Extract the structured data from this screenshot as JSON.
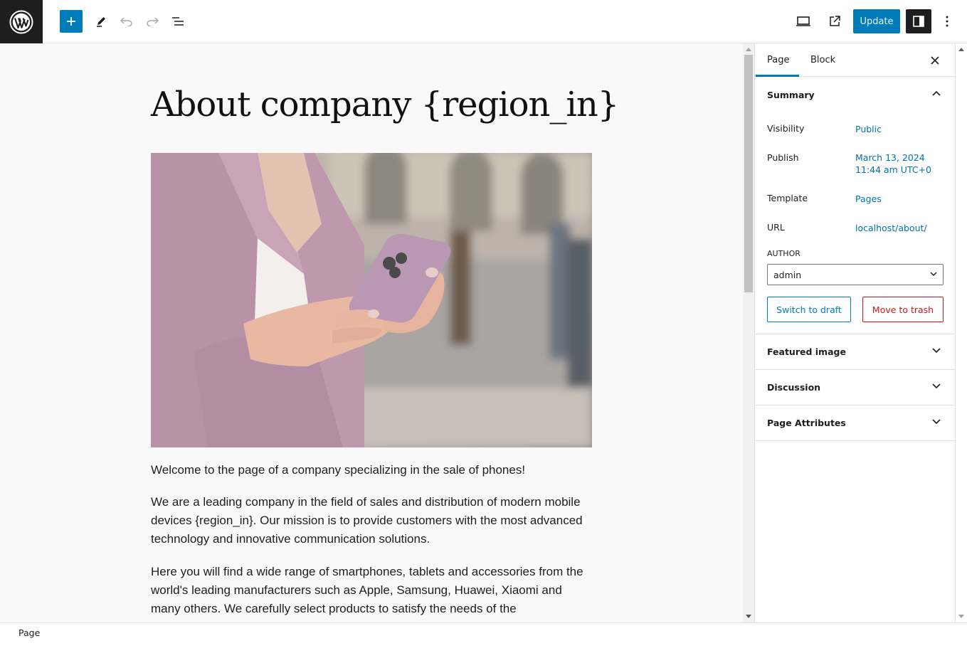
{
  "toolbar": {
    "update_label": "Update"
  },
  "editor": {
    "title": "About company {region_in}",
    "paragraphs": {
      "p1": "Welcome to the page of a company specializing in the sale of phones!",
      "p2": "We are a leading company in the field of sales and distribution of modern mobile devices {region_in}. Our mission is to provide customers with the most advanced technology and innovative communication solutions.",
      "p3": "Here you will find a wide range of smartphones, tablets and accessories from the world's leading manufacturers such as Apple, Samsung, Huawei, Xiaomi and many others. We carefully select products to satisfy the needs of the"
    }
  },
  "sidebar": {
    "tabs": {
      "page": "Page",
      "block": "Block"
    },
    "summary": {
      "heading": "Summary",
      "visibility_label": "Visibility",
      "visibility_value": "Public",
      "publish_label": "Publish",
      "publish_date": "March 13, 2024",
      "publish_time": "11:44 am UTC+0",
      "template_label": "Template",
      "template_value": "Pages",
      "url_label": "URL",
      "url_value": "localhost/about/",
      "author_label": "AUTHOR",
      "author_value": "admin",
      "switch_draft": "Switch to draft",
      "move_trash": "Move to trash"
    },
    "panels": {
      "featured": "Featured image",
      "discussion": "Discussion",
      "attributes": "Page Attributes"
    }
  },
  "footer": {
    "breadcrumb": "Page"
  },
  "colors": {
    "accent": "#007cba",
    "danger": "#cc1818",
    "dark": "#1e1e1e"
  }
}
